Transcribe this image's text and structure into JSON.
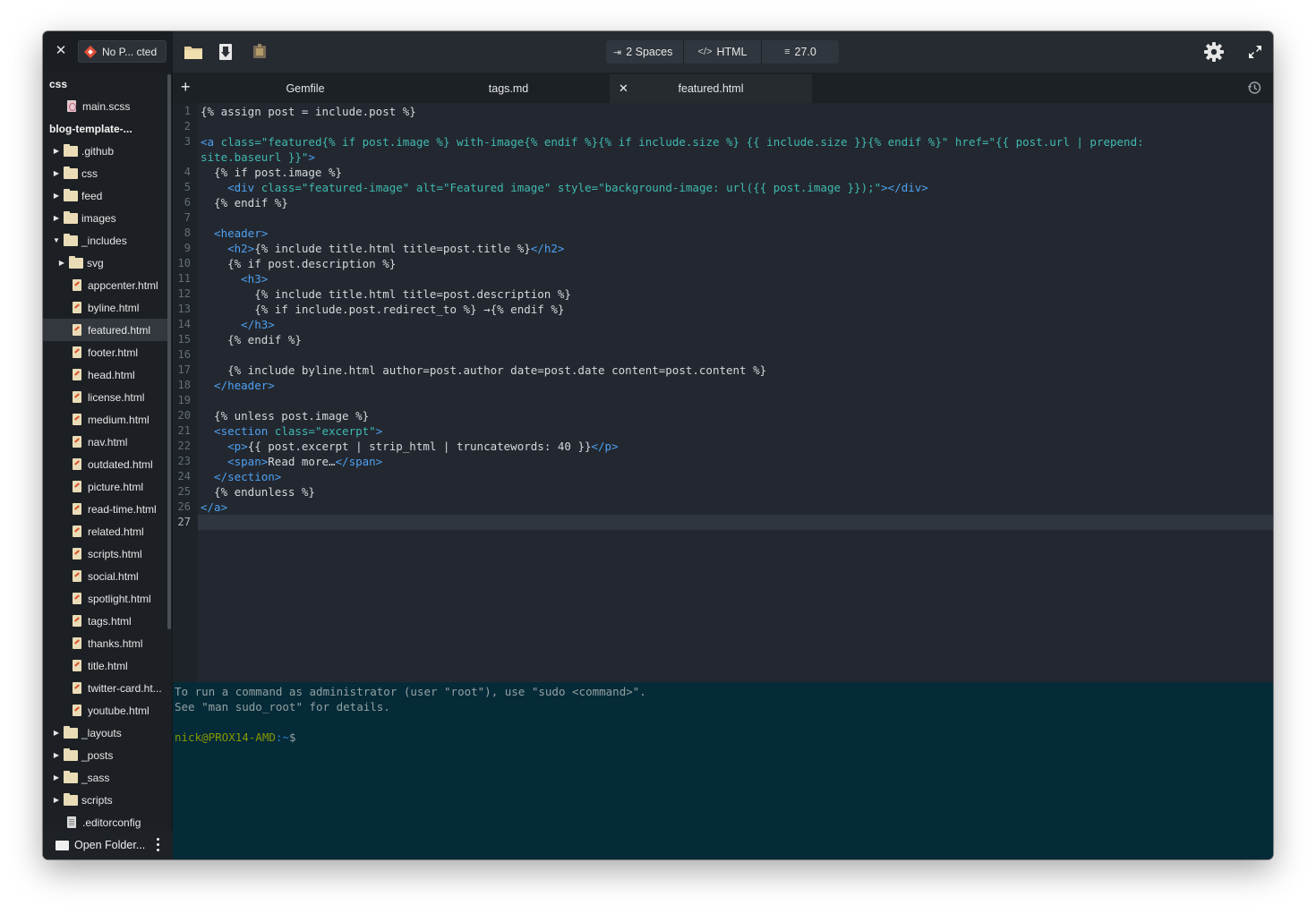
{
  "header": {
    "project_label": "No P... cted",
    "status": {
      "indent": "2 Spaces",
      "language": "HTML",
      "zoom": "27.0"
    }
  },
  "sidebar": {
    "items": [
      {
        "label": "css",
        "kind": "heading",
        "depth": 0
      },
      {
        "label": "main.scss",
        "kind": "file",
        "icon": "scss-file-icon",
        "depth": 1
      },
      {
        "label": "blog-template-...",
        "kind": "heading",
        "depth": 0
      },
      {
        "label": ".github",
        "kind": "folder",
        "depth": 0
      },
      {
        "label": "css",
        "kind": "folder",
        "depth": 0
      },
      {
        "label": "feed",
        "kind": "folder",
        "depth": 0
      },
      {
        "label": "images",
        "kind": "folder",
        "depth": 0
      },
      {
        "label": "_includes",
        "kind": "folder",
        "depth": 0,
        "open": true
      },
      {
        "label": "svg",
        "kind": "folder",
        "depth": 1
      },
      {
        "label": "appcenter.html",
        "kind": "file",
        "icon": "html-file-icon",
        "depth": 2
      },
      {
        "label": "byline.html",
        "kind": "file",
        "icon": "html-file-icon",
        "depth": 2
      },
      {
        "label": "featured.html",
        "kind": "file",
        "icon": "html-file-icon",
        "depth": 2,
        "selected": true
      },
      {
        "label": "footer.html",
        "kind": "file",
        "icon": "html-file-icon",
        "depth": 2
      },
      {
        "label": "head.html",
        "kind": "file",
        "icon": "html-file-icon",
        "depth": 2
      },
      {
        "label": "license.html",
        "kind": "file",
        "icon": "html-file-icon",
        "depth": 2
      },
      {
        "label": "medium.html",
        "kind": "file",
        "icon": "html-file-icon",
        "depth": 2
      },
      {
        "label": "nav.html",
        "kind": "file",
        "icon": "html-file-icon",
        "depth": 2
      },
      {
        "label": "outdated.html",
        "kind": "file",
        "icon": "html-file-icon",
        "depth": 2
      },
      {
        "label": "picture.html",
        "kind": "file",
        "icon": "html-file-icon",
        "depth": 2
      },
      {
        "label": "read-time.html",
        "kind": "file",
        "icon": "html-file-icon",
        "depth": 2
      },
      {
        "label": "related.html",
        "kind": "file",
        "icon": "html-file-icon",
        "depth": 2
      },
      {
        "label": "scripts.html",
        "kind": "file",
        "icon": "html-file-icon",
        "depth": 2
      },
      {
        "label": "social.html",
        "kind": "file",
        "icon": "html-file-icon",
        "depth": 2
      },
      {
        "label": "spotlight.html",
        "kind": "file",
        "icon": "html-file-icon",
        "depth": 2
      },
      {
        "label": "tags.html",
        "kind": "file",
        "icon": "html-file-icon",
        "depth": 2
      },
      {
        "label": "thanks.html",
        "kind": "file",
        "icon": "html-file-icon",
        "depth": 2
      },
      {
        "label": "title.html",
        "kind": "file",
        "icon": "html-file-icon",
        "depth": 2
      },
      {
        "label": "twitter-card.ht...",
        "kind": "file",
        "icon": "html-file-icon",
        "depth": 2
      },
      {
        "label": "youtube.html",
        "kind": "file",
        "icon": "html-file-icon",
        "depth": 2
      },
      {
        "label": "_layouts",
        "kind": "folder",
        "depth": 0
      },
      {
        "label": "_posts",
        "kind": "folder",
        "depth": 0
      },
      {
        "label": "_sass",
        "kind": "folder",
        "depth": 0
      },
      {
        "label": "scripts",
        "kind": "folder",
        "depth": 0
      },
      {
        "label": ".editorconfig",
        "kind": "file",
        "icon": "plain-file-icon",
        "depth": 1
      }
    ],
    "footer_label": "Open Folder..."
  },
  "tabs": [
    {
      "label": "Gemfile",
      "active": false
    },
    {
      "label": "tags.md",
      "active": false
    },
    {
      "label": "featured.html",
      "active": true
    }
  ],
  "editor": {
    "current_line": 27,
    "line_numbers": [
      "1",
      "2",
      "3",
      "",
      "4",
      "5",
      "6",
      "7",
      "8",
      "9",
      "10",
      "11",
      "12",
      "13",
      "14",
      "15",
      "16",
      "17",
      "18",
      "19",
      "20",
      "21",
      "22",
      "23",
      "24",
      "25",
      "26",
      "27"
    ],
    "lines": [
      [
        {
          "t": "{% assign post = include.post %}",
          "c": "tx"
        }
      ],
      [],
      [
        {
          "t": "<a",
          "c": "tg"
        },
        {
          "t": " class=",
          "c": "at"
        },
        {
          "t": "\"featured{% if post.image %} with-image{% endif %}{% if include.size %} {{ include.size }}{% endif %}\"",
          "c": "st"
        },
        {
          "t": " href=",
          "c": "at"
        },
        {
          "t": "\"{{ post.url | prepend:",
          "c": "st"
        }
      ],
      [
        {
          "t": "site.baseurl }}\"",
          "c": "st"
        },
        {
          "t": ">",
          "c": "tg"
        }
      ],
      [
        {
          "t": "  {% if post.image %}",
          "c": "tx"
        }
      ],
      [
        {
          "t": "    <div",
          "c": "tg"
        },
        {
          "t": " class=",
          "c": "at"
        },
        {
          "t": "\"featured-image\"",
          "c": "st"
        },
        {
          "t": " alt=",
          "c": "at"
        },
        {
          "t": "\"Featured image\"",
          "c": "st"
        },
        {
          "t": " style=",
          "c": "at"
        },
        {
          "t": "\"background-image: url({{ post.image }});\"",
          "c": "st"
        },
        {
          "t": "></div>",
          "c": "tg"
        }
      ],
      [
        {
          "t": "  {% endif %}",
          "c": "tx"
        }
      ],
      [],
      [
        {
          "t": "  <header>",
          "c": "tg"
        }
      ],
      [
        {
          "t": "    <h2>",
          "c": "tg"
        },
        {
          "t": "{% include title.html title=post.title %}",
          "c": "tx"
        },
        {
          "t": "</h2>",
          "c": "tg"
        }
      ],
      [
        {
          "t": "    {% if post.description %}",
          "c": "tx"
        }
      ],
      [
        {
          "t": "      <h3>",
          "c": "tg"
        }
      ],
      [
        {
          "t": "        {% include title.html title=post.description %}",
          "c": "tx"
        }
      ],
      [
        {
          "t": "        {% if include.post.redirect_to %} →{% endif %}",
          "c": "tx"
        }
      ],
      [
        {
          "t": "      </h3>",
          "c": "tg"
        }
      ],
      [
        {
          "t": "    {% endif %}",
          "c": "tx"
        }
      ],
      [],
      [
        {
          "t": "    {% include byline.html author=post.author date=post.date content=post.content %}",
          "c": "tx"
        }
      ],
      [
        {
          "t": "  </header>",
          "c": "tg"
        }
      ],
      [],
      [
        {
          "t": "  {% unless post.image %}",
          "c": "tx"
        }
      ],
      [
        {
          "t": "  <section",
          "c": "tg"
        },
        {
          "t": " class=",
          "c": "at"
        },
        {
          "t": "\"excerpt\"",
          "c": "st"
        },
        {
          "t": ">",
          "c": "tg"
        }
      ],
      [
        {
          "t": "    <p>",
          "c": "tg"
        },
        {
          "t": "{{ post.excerpt | strip_html | truncatewords: 40 }}",
          "c": "tx"
        },
        {
          "t": "</p>",
          "c": "tg"
        }
      ],
      [
        {
          "t": "    <span>",
          "c": "tg"
        },
        {
          "t": "Read more…",
          "c": "tx"
        },
        {
          "t": "</span>",
          "c": "tg"
        }
      ],
      [
        {
          "t": "  </section>",
          "c": "tg"
        }
      ],
      [
        {
          "t": "  {% endunless %}",
          "c": "tx"
        }
      ],
      [
        {
          "t": "</a>",
          "c": "tg"
        }
      ],
      []
    ]
  },
  "terminal": {
    "lines": [
      "To run a command as administrator (user \"root\"), use \"sudo <command>\".",
      "See \"man sudo_root\" for details.",
      ""
    ],
    "prompt_user": "nick@PROX14-AMD",
    "prompt_path": ":~",
    "prompt_symbol": "$"
  }
}
